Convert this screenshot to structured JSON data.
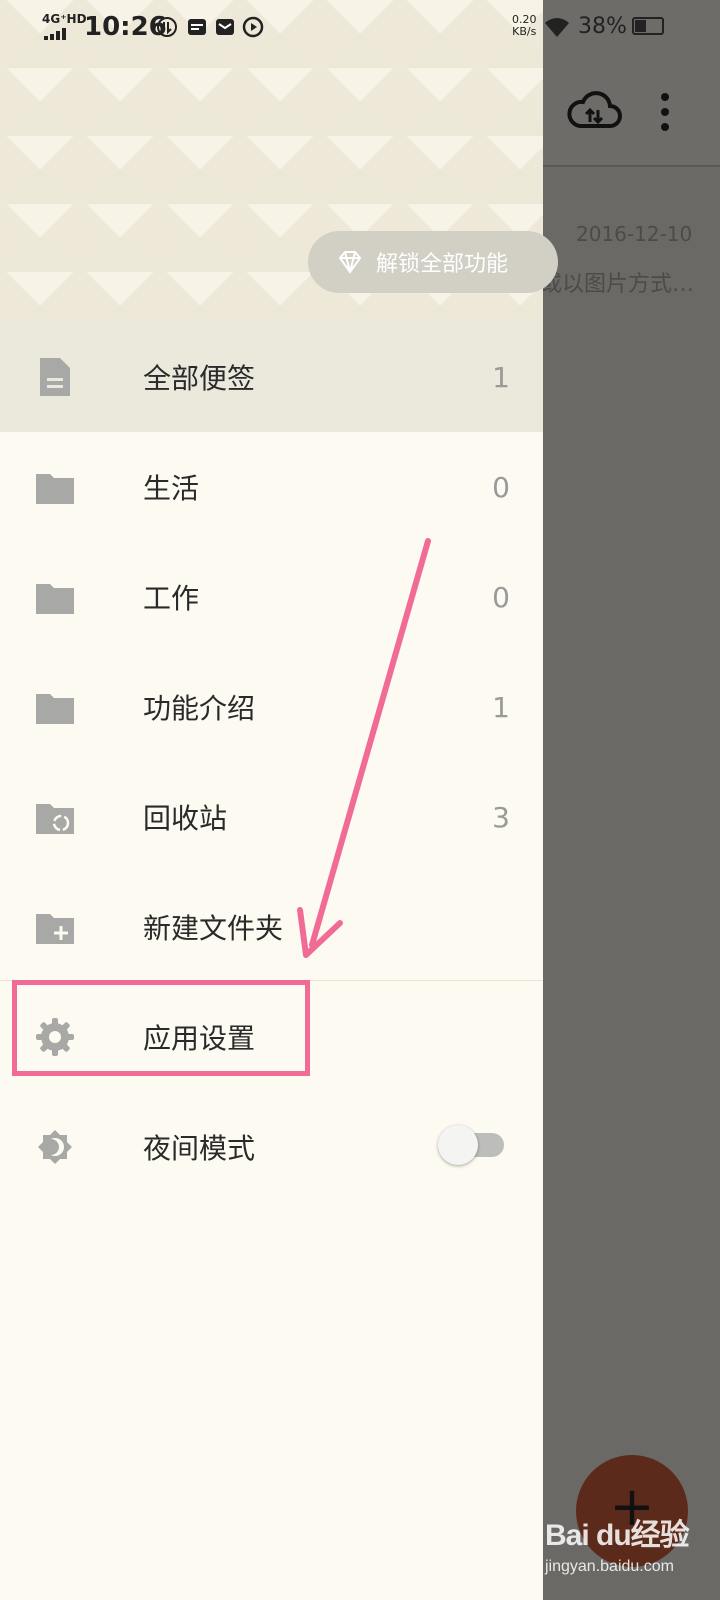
{
  "status_bar": {
    "network": "4G⁺HD",
    "time": "10:26",
    "speed_value": "0.20",
    "speed_unit": "KB/s",
    "battery": "38%"
  },
  "background_app": {
    "toolbar_icons": [
      "cloud-sync-icon",
      "more-vert-icon"
    ],
    "note_date": "2016-12-10",
    "note_snippet": "或以图片方式…",
    "fab_label": "+"
  },
  "drawer": {
    "unlock_label": "解锁全部功能",
    "items": [
      {
        "label": "全部便签",
        "count": "1",
        "icon": "note-icon"
      },
      {
        "label": "生活",
        "count": "0",
        "icon": "folder-icon"
      },
      {
        "label": "工作",
        "count": "0",
        "icon": "folder-icon"
      },
      {
        "label": "功能介绍",
        "count": "1",
        "icon": "folder-icon"
      },
      {
        "label": "回收站",
        "count": "3",
        "icon": "recycle-folder-icon"
      },
      {
        "label": "新建文件夹",
        "icon": "new-folder-icon"
      },
      {
        "label": "应用设置",
        "icon": "gear-icon"
      },
      {
        "label": "夜间模式",
        "icon": "night-mode-icon",
        "toggle_on": false
      }
    ]
  },
  "watermark": {
    "logo": "Bai du经验",
    "url": "jingyan.baidu.com"
  },
  "colors": {
    "accent_annotation": "#f06c96",
    "drawer_bg": "#fdfbf1",
    "selected_bg": "#ebe8dc",
    "icon_gray": "#a8a8a6"
  }
}
